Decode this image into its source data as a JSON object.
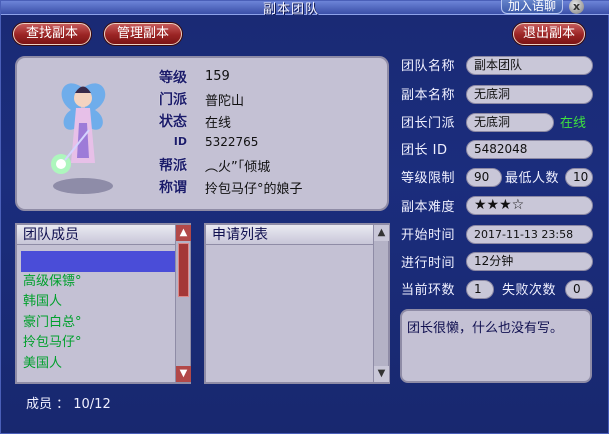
{
  "window": {
    "title": "副本团队",
    "join_chat": "加入语聊",
    "close_glyph": "x"
  },
  "toolbar": {
    "find": "查找副本",
    "manage": "管理副本",
    "quit": "退出副本"
  },
  "character": {
    "fields": [
      {
        "label": "等级",
        "value": "159"
      },
      {
        "label": "门派",
        "value": "普陀山"
      },
      {
        "label": "状态",
        "value": "在线"
      },
      {
        "label": "ID",
        "value": "5322765"
      },
      {
        "label": "帮派",
        "value": "︵火”「倾城"
      },
      {
        "label": "称谓",
        "value": "拎包马仔°的娘子"
      }
    ]
  },
  "team": {
    "name_label": "团队名称",
    "name_value": "副本团队",
    "dungeon_label": "副本名称",
    "dungeon_value": "无底洞",
    "leader_school_label": "团长门派",
    "leader_school_value": "无底洞",
    "leader_status": "在线",
    "leader_label": "团长 ID",
    "leader_value": "5482048",
    "level_limit_label": "等级限制",
    "level_limit_value": "90",
    "min_people_label": "最低人数",
    "min_people_value": "10",
    "difficulty_label": "副本难度",
    "difficulty_value": "★★★☆",
    "start_label": "开始时间",
    "start_value": "2017-11-13 23:58",
    "elapsed_label": "进行时间",
    "elapsed_value": "12分钟",
    "round_label": "当前环数",
    "round_value": "1",
    "fail_label": "失败次数",
    "fail_value": "0",
    "memo": "团长很懒，什么也没有写。"
  },
  "members_panel": {
    "header": "团队成员",
    "members": [
      "　　　",
      "高级保镖°",
      "韩国人",
      "豪门白总°",
      "拎包马仔°",
      "美国人"
    ],
    "count_label": "成员 ： 10/12"
  },
  "applications_panel": {
    "header": "申请列表"
  },
  "icons": {
    "scroll_up": "scroll-up-arrow-icon",
    "scroll_down": "scroll-down-arrow-icon"
  },
  "colors": {
    "background": "#1b2d7d",
    "button": "#9a2424",
    "online": "#3ee23e",
    "member_text": "#00a02c",
    "selected_row": "#4a4dd8"
  }
}
